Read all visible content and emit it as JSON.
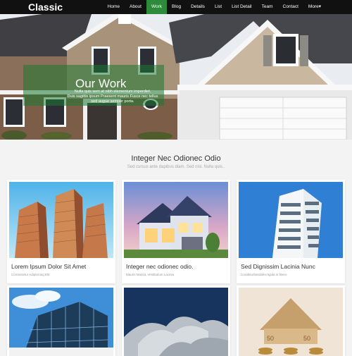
{
  "brand": "Classic",
  "nav": {
    "items": [
      "Home",
      "About",
      "Work",
      "Blog",
      "Details",
      "List",
      "List Detail",
      "Team",
      "Contact",
      "More"
    ],
    "active_index": 2,
    "more_caret": "▾"
  },
  "hero": {
    "title": "Our Work",
    "lines": [
      "Nulla quis sem at nibh elementum imperdiet.",
      "Duis sagittis ipsum Praesent mauris Fusce nec tellus",
      "sed augue semper porta."
    ]
  },
  "section": {
    "title": "Integer Nec Odionec Odio",
    "subtitle": "Sed cursus ante dapibus diam. Sed nisi. Nulla quis.."
  },
  "cards": [
    {
      "title": "Lorem Ipsum Dolor Sit Amet",
      "caption": "Consectetur Adipisicing Elit",
      "image": "high-rise-towers"
    },
    {
      "title": "Integer nec odionec odio.",
      "caption": "Mauris Massa, Vestibulum Lacinia",
      "image": "suburban-house-dusk"
    },
    {
      "title": "Sed Dignissim Lacinia Nunc",
      "caption": "Curabiturbandales ligula in libero",
      "image": "modern-apartment-tower"
    },
    {
      "title": "",
      "caption": "",
      "image": "glass-office-building"
    },
    {
      "title": "",
      "caption": "",
      "image": "curved-metal-architecture"
    },
    {
      "title": "",
      "caption": "",
      "image": "euro-banknote-house-on-coins"
    }
  ]
}
